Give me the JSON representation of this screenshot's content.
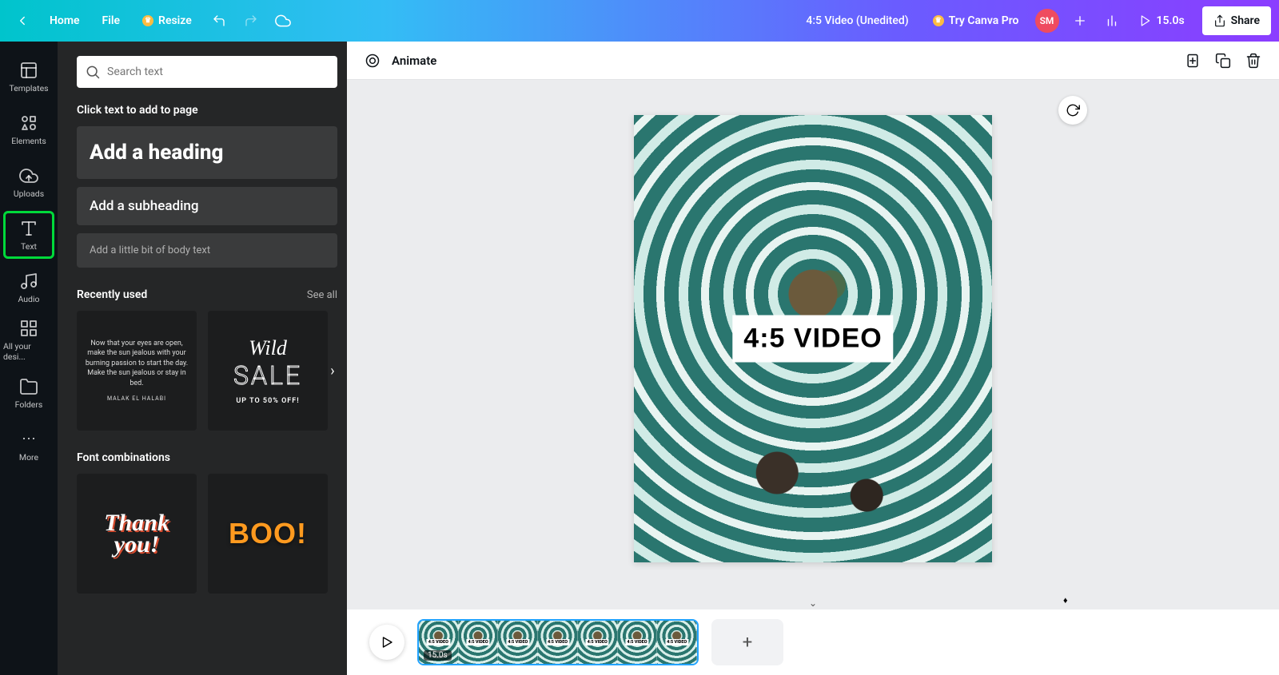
{
  "topbar": {
    "home": "Home",
    "file": "File",
    "resize": "Resize",
    "doc_title": "4:5 Video (Unedited)",
    "try_pro": "Try Canva Pro",
    "avatar_initials": "SM",
    "duration": "15.0s",
    "share": "Share"
  },
  "rail": {
    "templates": "Templates",
    "elements": "Elements",
    "uploads": "Uploads",
    "text": "Text",
    "audio": "Audio",
    "all_designs": "All your desi...",
    "folders": "Folders",
    "more": "More"
  },
  "panel": {
    "search_placeholder": "Search text",
    "click_hint": "Click text to add to page",
    "add_heading": "Add a heading",
    "add_subheading": "Add a subheading",
    "add_body": "Add a little bit of body text",
    "recently_used": "Recently used",
    "see_all": "See all",
    "quote_text": "Now that your eyes are open, make the sun jealous with your burning passion to start the day. Make the sun jealous or stay in bed.",
    "quote_author": "MALAK EL HALABI",
    "sale_cursive": "Wild",
    "sale_big": "SALE",
    "sale_sub": "UP TO 50% OFF!",
    "font_combos": "Font combinations",
    "thank_you": "Thank you!",
    "boo": "BOO!"
  },
  "context": {
    "animate": "Animate"
  },
  "canvas": {
    "label": "4:5 VIDEO"
  },
  "timeline": {
    "clip_duration": "15.0s",
    "frame_label": "4:5 VIDEO"
  }
}
